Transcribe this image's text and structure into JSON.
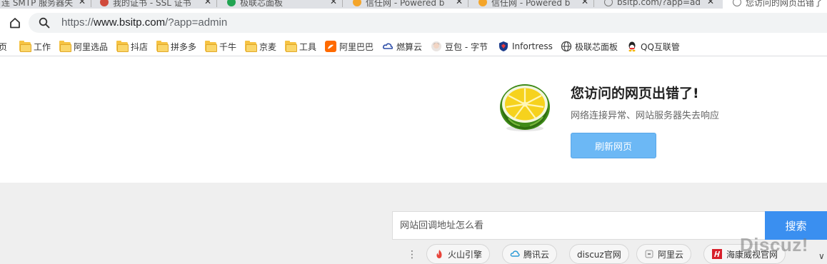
{
  "tabs": [
    {
      "title": "连 SMTP 服务器失",
      "fav": "#7a7a7a"
    },
    {
      "title": "我的证书 - SSL 证书",
      "fav": "#d04a3b"
    },
    {
      "title": "极联芯面板",
      "fav": "#21a452"
    },
    {
      "title": "信任网 - Powered b",
      "fav": "#f4a52a"
    },
    {
      "title": "信任网 - Powered b",
      "fav": "#f4a52a"
    },
    {
      "title": "bsitp.com/?app=ad",
      "fav": "#777777"
    },
    {
      "title": "您访问的网页出错了",
      "fav": "#777777"
    }
  ],
  "address": {
    "scheme": "https://",
    "host": "www.bsitp.com",
    "path": "/?app=admin"
  },
  "bookmarks": [
    {
      "label": "页",
      "icon": "none"
    },
    {
      "label": "工作",
      "icon": "folder"
    },
    {
      "label": "阿里选品",
      "icon": "folder"
    },
    {
      "label": "抖店",
      "icon": "folder"
    },
    {
      "label": "拼多多",
      "icon": "folder"
    },
    {
      "label": "千牛",
      "icon": "folder"
    },
    {
      "label": "京麦",
      "icon": "folder"
    },
    {
      "label": "工具",
      "icon": "folder"
    },
    {
      "label": "阿里巴巴",
      "icon": "alibaba-icon"
    },
    {
      "label": "燃算云",
      "icon": "cloud-icon"
    },
    {
      "label": "豆包 - 字节",
      "icon": "doubao-icon"
    },
    {
      "label": "Infortress",
      "icon": "infortress-icon"
    },
    {
      "label": "极联芯面板",
      "icon": "globe-icon"
    },
    {
      "label": "QQ互联管",
      "icon": "qq-icon"
    }
  ],
  "error": {
    "title": "您访问的网页出错了!",
    "subtitle": "网络连接异常、网站服务器失去响应",
    "refresh_label": "刷新网页"
  },
  "search": {
    "placeholder": "网站回调地址怎么看",
    "button_label": "搜索"
  },
  "quick_links": [
    {
      "label": "火山引擎",
      "icon": "volcano-icon"
    },
    {
      "label": "腾讯云",
      "icon": "tencent-cloud-icon"
    },
    {
      "label": "discuz官网",
      "icon": "none"
    },
    {
      "label": "阿里云",
      "icon": "aliyun-icon"
    },
    {
      "label": "海康威视官网",
      "icon": "hikvision-icon"
    }
  ],
  "watermark": "Discuz!",
  "colors": {
    "accent": "#3a8ff0",
    "refresh_button": "#6cb8f5",
    "folder": "#f6c343"
  }
}
